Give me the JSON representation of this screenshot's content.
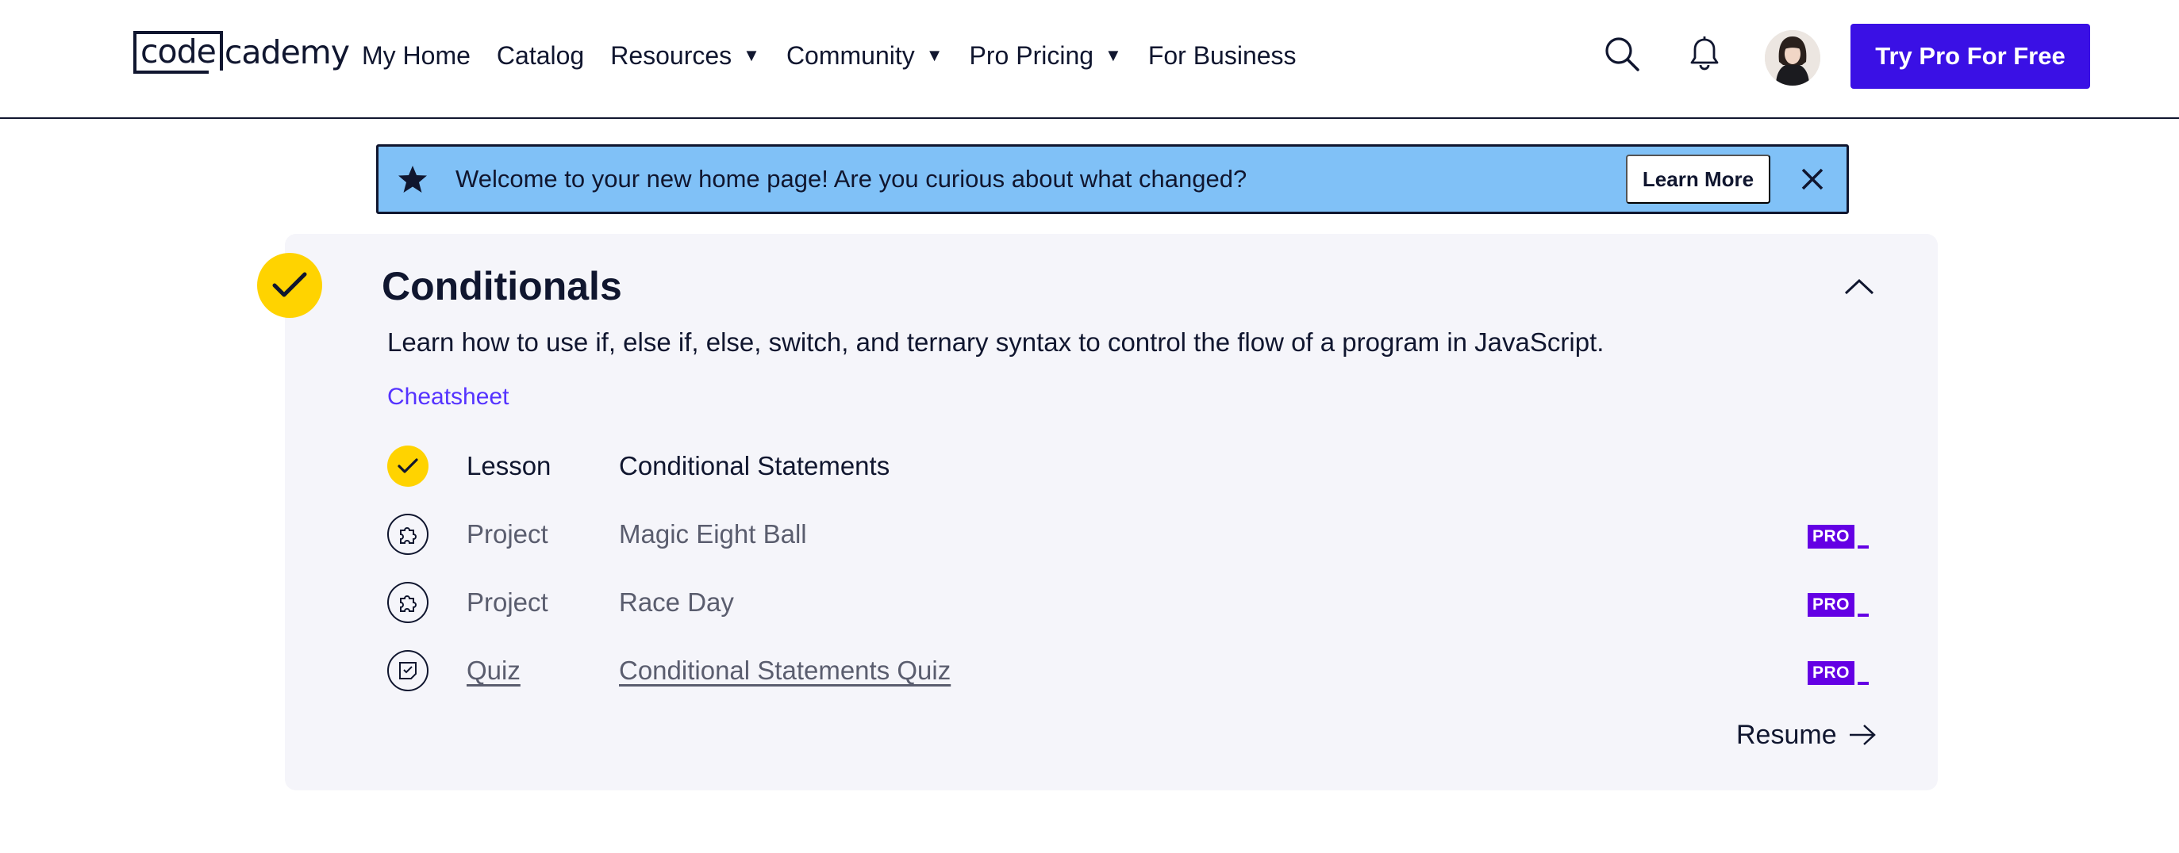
{
  "header": {
    "logo": {
      "part1": "code",
      "part2": "cademy"
    },
    "nav": [
      {
        "label": "My Home",
        "has_caret": false
      },
      {
        "label": "Catalog",
        "has_caret": false
      },
      {
        "label": "Resources",
        "has_caret": true
      },
      {
        "label": "Community",
        "has_caret": true
      },
      {
        "label": "Pro Pricing",
        "has_caret": true
      },
      {
        "label": "For Business",
        "has_caret": false
      }
    ],
    "caret_glyph": "▼",
    "icons": [
      "search-icon",
      "bell-icon",
      "avatar"
    ],
    "cta_label": "Try Pro For Free",
    "cta_color": "#3a10e5"
  },
  "banner": {
    "message": "Welcome to your new home page! Are you curious about what changed?",
    "button_label": "Learn More",
    "background": "#80c1f7",
    "icons": [
      "star-icon",
      "close-icon"
    ]
  },
  "module": {
    "title": "Conditionals",
    "description": "Learn how to use if, else if, else, switch, and ternary syntax to control the flow of a program in JavaScript.",
    "cheatsheet_label": "Cheatsheet",
    "completed": true,
    "items": [
      {
        "type": "Lesson",
        "name": "Conditional Statements",
        "status": "completed",
        "icon": "check-icon",
        "pro": false
      },
      {
        "type": "Project",
        "name": "Magic Eight Ball",
        "status": "locked",
        "icon": "puzzle-icon",
        "pro": true
      },
      {
        "type": "Project",
        "name": "Race Day",
        "status": "locked",
        "icon": "puzzle-icon",
        "pro": true
      },
      {
        "type": "Quiz",
        "name": "Conditional Statements Quiz",
        "status": "link",
        "icon": "quiz-icon",
        "pro": true
      }
    ],
    "pro_badge": "PRO",
    "resume_label": "Resume"
  },
  "colors": {
    "navy": "#10162f",
    "yellow": "#ffd300",
    "purple_link": "#5533ff",
    "pro_purple": "#6400e4",
    "card_bg": "#f5f5fa"
  }
}
